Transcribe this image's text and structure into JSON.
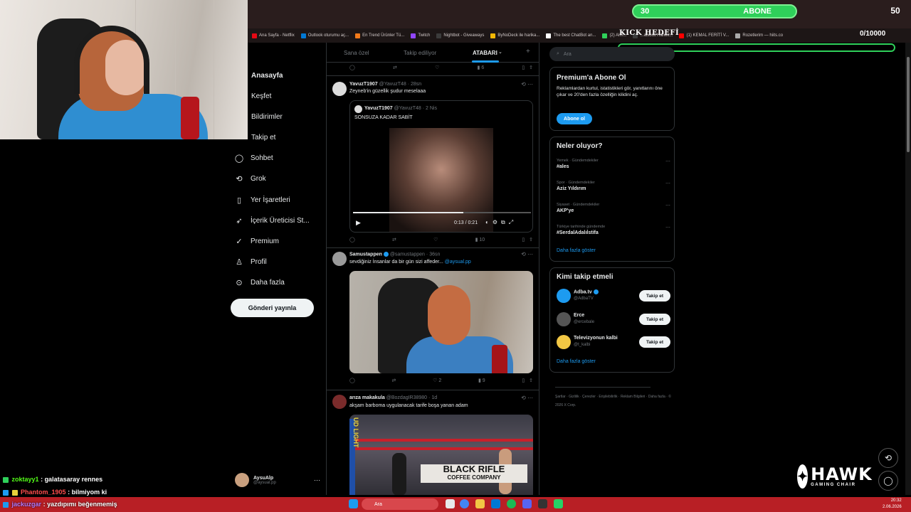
{
  "bookmarks": [
    {
      "label": "Ana Sayfa - Netflix",
      "color": "#e50914"
    },
    {
      "label": "Outlook oturumu aç...",
      "color": "#0078d4"
    },
    {
      "label": "En Trend Ürünler Tü...",
      "color": "#f27a1a"
    },
    {
      "label": "Twitch",
      "color": "#9146ff"
    },
    {
      "label": "Nightbot - Giveaways",
      "color": "#3b3b3b"
    },
    {
      "label": "ByNoDeck ile harika...",
      "color": "#f2b705"
    },
    {
      "label": "The best ChatBot an...",
      "color": "#ffffff"
    },
    {
      "label": "(2) Alm...",
      "color": "#2fd05a"
    },
    {
      "label": "...alsoist Hanek...",
      "color": "#3b3b3b"
    },
    {
      "label": "(1) KEMAL FERİTİ V...",
      "color": "#ff0000"
    },
    {
      "label": "Rozetlerim — hiits.co",
      "color": "#aaaaaa"
    }
  ],
  "kick": {
    "abone_current": "30",
    "abone_label": "ABONE",
    "abone_target": "50",
    "goal_label": "KICK HEDEFİ",
    "goal_count": "0/10000"
  },
  "nav": {
    "items": [
      {
        "label": "Anasayfa",
        "icon": "home-icon"
      },
      {
        "label": "Keşfet",
        "icon": "search-icon"
      },
      {
        "label": "Bildirimler",
        "icon": "bell-icon"
      },
      {
        "label": "Takip et",
        "icon": "users-icon"
      },
      {
        "label": "Sohbet",
        "icon": "chat-icon"
      },
      {
        "label": "Grok",
        "icon": "grok-icon"
      },
      {
        "label": "Yer İşaretleri",
        "icon": "bookmark-icon"
      },
      {
        "label": "İçerik Üreticisi St...",
        "icon": "rocket-icon"
      },
      {
        "label": "Premium",
        "icon": "premium-icon"
      },
      {
        "label": "Profil",
        "icon": "person-icon"
      },
      {
        "label": "Daha fazla",
        "icon": "more-circle-icon"
      }
    ],
    "post_button": "Gönderi yayınla",
    "profile_name": "AysuAlp",
    "profile_handle": "@aysual.pp"
  },
  "feed": {
    "tabs": [
      "Sana özel",
      "Takip ediliyor",
      "ATABARI"
    ],
    "top_actions": {
      "views": "6"
    },
    "tweets": [
      {
        "name": "YavuzT1907",
        "handle": "@YavuzT48",
        "time": "28sn",
        "text": "Zeyneb'in güzellik şudur meselaaa",
        "quote_name": "YavuzT1907",
        "quote_handle": "@YavuzT48",
        "quote_time": "2 Nis",
        "quote_text": "SONSUZA KADAR SABİT",
        "video_time": "0:13 / 0:21",
        "views": "10"
      },
      {
        "name": "Samustappen",
        "handle": "@samustappen",
        "time": "36sn",
        "text": "sevdiğiniz İnsanlar da bir gün sizi affeder...",
        "mention": "@aysual.pp",
        "replies": "",
        "likes": "2",
        "views": "9"
      },
      {
        "name": "arıza makakula",
        "handle": "@BozdagIR38980",
        "time": "1d",
        "text": "akşam barboma uygulanacak tarife boşa yanan adam",
        "ad_text_1": "BLACK RIFLE",
        "ad_text_2": "COFFEE COMPANY",
        "ad_text_3": "UD LIGHT"
      }
    ]
  },
  "right": {
    "search_placeholder": "Ara",
    "premium_title": "Premium'a Abone Ol",
    "premium_text": "Reklamlardan kurtul, istatistikleri gör, yanıtlarını öne çıkar ve 20'den fazla özelliğin kilidini aç.",
    "premium_button": "Abone ol",
    "trends_title": "Neler oluyor?",
    "trends": [
      {
        "category": "Yemek · Gündemdekiler",
        "name": "#ales"
      },
      {
        "category": "Spor · Gündemdekiler",
        "name": "Aziz Yıldırım"
      },
      {
        "category": "Siyaset · Gündemdekiler",
        "name": "AKP'ye"
      },
      {
        "category": "Türkiye tarihinde gündemde",
        "name": "#SerdalAdalıİstifa"
      }
    ],
    "show_more": "Daha fazla göster",
    "who_title": "Kimi takip etmeli",
    "suggestions": [
      {
        "name": "Adba.tv",
        "handle": "@AdbaTV",
        "avatar_color": "#1d9bf0"
      },
      {
        "name": "Erce",
        "handle": "@ercebale",
        "avatar_color": "#555555"
      },
      {
        "name": "Televizyonun kalbi",
        "handle": "@t_kalbi",
        "avatar_color": "#f2c744"
      }
    ],
    "follow_label": "Takip et",
    "footer": "Şartlar · Gizlilik · Çerezler · Erişilebilirlik · Reklam Bilgileri · Daha fazla · © 2026 X Corp."
  },
  "chat": [
    {
      "user": "zoktayy1",
      "message": "galatasaray rennes",
      "color": "#53fc18"
    },
    {
      "user": "Phantom_1905",
      "message": "bilmiyom ki",
      "color": "#ff4d4d"
    },
    {
      "user": "jackuzgar",
      "message": "yazdıpımı beğenmemiş",
      "color": "#b57bff"
    }
  ],
  "taskbar": {
    "search": "Ara",
    "time": "20:32",
    "date": "2.06.2026"
  },
  "brand": {
    "logo_main": "HAWK",
    "logo_sub": "GAMING CHAIR"
  }
}
